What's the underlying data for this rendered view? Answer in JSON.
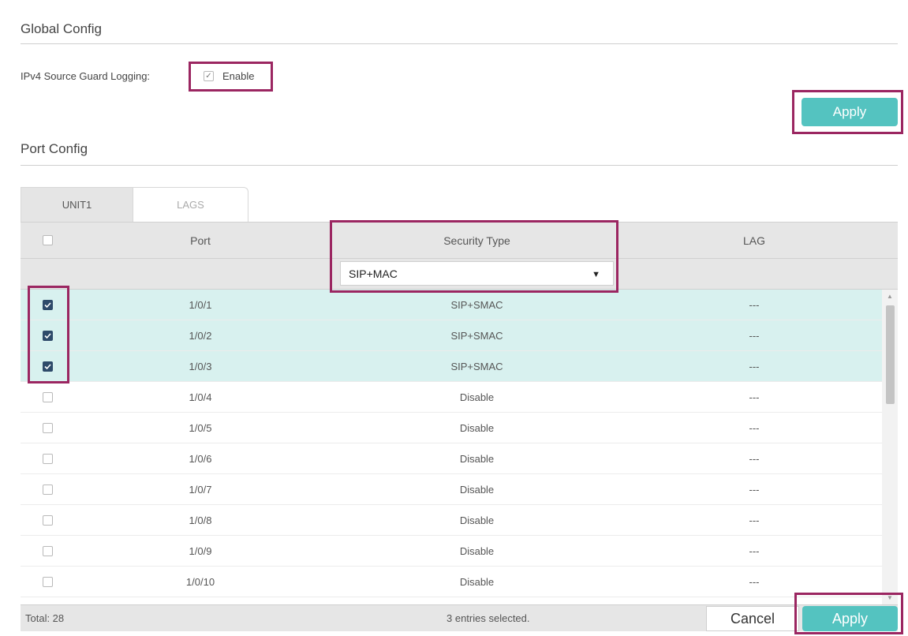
{
  "global": {
    "title": "Global Config",
    "logging_label": "IPv4 Source Guard Logging:",
    "enable_label": "Enable",
    "apply_label": "Apply"
  },
  "port_config": {
    "title": "Port Config",
    "tabs": [
      {
        "label": "UNIT1",
        "active": true
      },
      {
        "label": "LAGS",
        "active": false
      }
    ],
    "columns": {
      "port": "Port",
      "security_type": "Security Type",
      "lag": "LAG"
    },
    "filter_value": "SIP+MAC",
    "rows": [
      {
        "port": "1/0/1",
        "security": "SIP+SMAC",
        "lag": "---",
        "checked": true
      },
      {
        "port": "1/0/2",
        "security": "SIP+SMAC",
        "lag": "---",
        "checked": true
      },
      {
        "port": "1/0/3",
        "security": "SIP+SMAC",
        "lag": "---",
        "checked": true
      },
      {
        "port": "1/0/4",
        "security": "Disable",
        "lag": "---",
        "checked": false
      },
      {
        "port": "1/0/5",
        "security": "Disable",
        "lag": "---",
        "checked": false
      },
      {
        "port": "1/0/6",
        "security": "Disable",
        "lag": "---",
        "checked": false
      },
      {
        "port": "1/0/7",
        "security": "Disable",
        "lag": "---",
        "checked": false
      },
      {
        "port": "1/0/8",
        "security": "Disable",
        "lag": "---",
        "checked": false
      },
      {
        "port": "1/0/9",
        "security": "Disable",
        "lag": "---",
        "checked": false
      },
      {
        "port": "1/0/10",
        "security": "Disable",
        "lag": "---",
        "checked": false
      }
    ],
    "total": "Total: 28",
    "selected": "3 entries selected.",
    "cancel_label": "Cancel",
    "apply_label": "Apply"
  },
  "colors": {
    "accent": "#54c3c0",
    "highlight": "#9b2661",
    "selected_row": "#d8f1ef",
    "checkbox": "#2e4a6a"
  }
}
